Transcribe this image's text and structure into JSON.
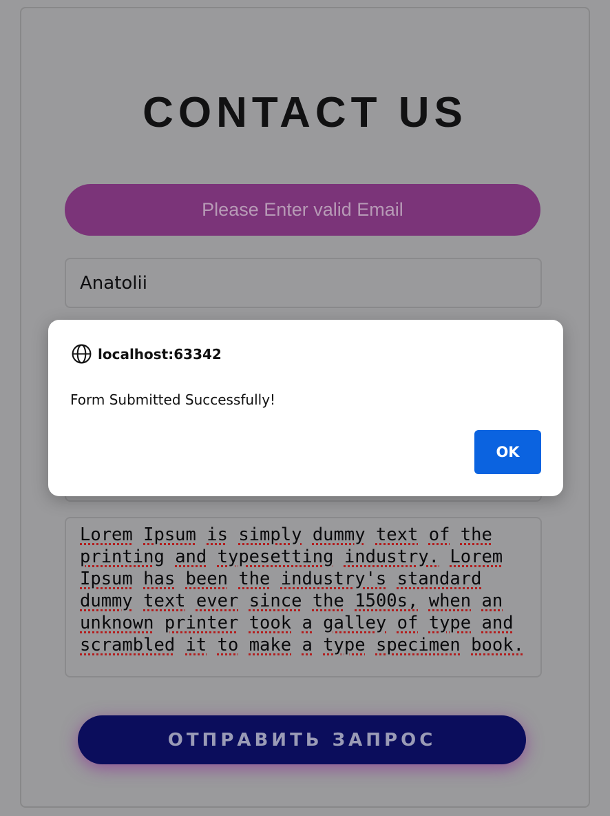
{
  "form": {
    "title": "CONTACT US",
    "error_message": "Please Enter valid Email",
    "name_value": "Anatolii",
    "message_words": [
      "Lorem",
      "Ipsum",
      "is",
      "simply",
      "dummy",
      "text",
      "of",
      "the",
      "printing",
      "and",
      "typesetting",
      "industry.",
      "Lorem",
      "Ipsum",
      "has",
      "been",
      "the",
      "industry's",
      "standard",
      "dummy",
      "text",
      "ever",
      "since",
      "the",
      "1500s,",
      "when",
      "an",
      "unknown",
      "printer",
      "took",
      "a",
      "galley",
      "of",
      "type",
      "and",
      "scrambled",
      "it",
      "to",
      "make",
      "a",
      "type",
      "specimen",
      "book."
    ],
    "submit_label": "ОТПРАВИТЬ ЗАПРОС"
  },
  "dialog": {
    "origin": "localhost:63342",
    "message": "Form Submitted Successfully!",
    "ok_label": "OK",
    "origin_icon": "globe-icon"
  },
  "colors": {
    "error_banner_bg": "#7b3479",
    "submit_bg": "#0b0d5c",
    "ok_bg": "#0b63e0"
  }
}
